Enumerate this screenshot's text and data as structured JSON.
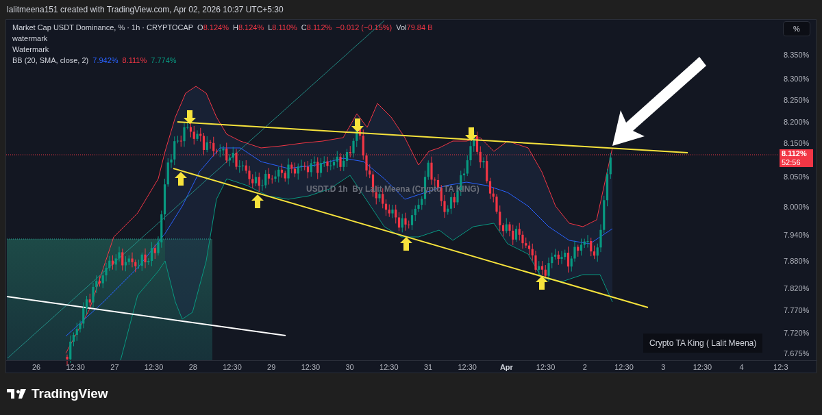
{
  "header": {
    "text": "lalitmeena151 created with TradingView.com, Apr 02, 2026 10:37 UTC+5:30"
  },
  "legend": {
    "symbol": "Market Cap USDT Dominance, % · 1h · CRYPTOCAP",
    "ohlc": [
      {
        "label": "O",
        "value": "8.124%"
      },
      {
        "label": "H",
        "value": "8.124%"
      },
      {
        "label": "L",
        "value": "8.110%"
      },
      {
        "label": "C",
        "value": "8.112%"
      }
    ],
    "change": "−0.012 (−0.15%)",
    "volume": {
      "label": "Vol",
      "value": "79.84 B"
    },
    "lines": [
      "watermark",
      "Watermark"
    ],
    "indicator": {
      "name": "BB (20, SMA, close, 2)",
      "values": [
        {
          "value": "7.942%",
          "color": "#2962ff"
        },
        {
          "value": "8.111%",
          "color": "#f23645"
        },
        {
          "value": "7.774%",
          "color": "#089981"
        }
      ]
    }
  },
  "scale_button": "%",
  "price_axis": {
    "ticks": [
      "8.350%",
      "8.300%",
      "8.250%",
      "8.200%",
      "8.150%",
      "8.050%",
      "8.000%",
      "7.940%",
      "7.880%",
      "7.820%",
      "7.770%",
      "7.720%",
      "7.675%"
    ],
    "last_price": "8.112%",
    "countdown": "52:56"
  },
  "time_axis": {
    "ticks": [
      {
        "label": "26",
        "kind": "day"
      },
      {
        "label": "12:30",
        "kind": "time"
      },
      {
        "label": "27",
        "kind": "day"
      },
      {
        "label": "12:30",
        "kind": "time"
      },
      {
        "label": "28",
        "kind": "day"
      },
      {
        "label": "12:30",
        "kind": "time"
      },
      {
        "label": "29",
        "kind": "day"
      },
      {
        "label": "12:30",
        "kind": "time"
      },
      {
        "label": "30",
        "kind": "day"
      },
      {
        "label": "12:30",
        "kind": "time"
      },
      {
        "label": "31",
        "kind": "day"
      },
      {
        "label": "12:30",
        "kind": "time"
      },
      {
        "label": "Apr",
        "kind": "month"
      },
      {
        "label": "12:30",
        "kind": "time"
      },
      {
        "label": "2",
        "kind": "day"
      },
      {
        "label": "12:30",
        "kind": "time"
      },
      {
        "label": "3",
        "kind": "day"
      },
      {
        "label": "12:30",
        "kind": "time"
      },
      {
        "label": "4",
        "kind": "day"
      },
      {
        "label": "12:3",
        "kind": "time"
      }
    ]
  },
  "chart_caption": "USDT.D 1h  By Lalit Meena (Crypto TA KING)",
  "label_box": "Crypto TA King ( Lalit Meena)",
  "footer": {
    "brand": "TradingView"
  }
}
